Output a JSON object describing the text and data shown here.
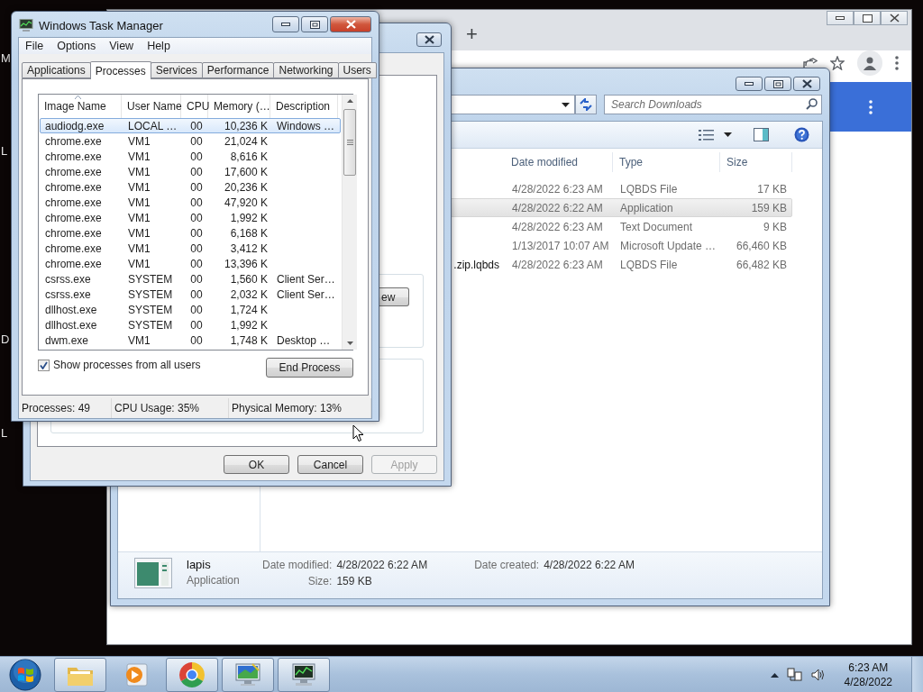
{
  "desktop": {
    "edge_letters": [
      "M",
      "L",
      "D",
      "L"
    ]
  },
  "browser": {
    "new_tab_button": "+"
  },
  "explorer": {
    "search": {
      "placeholder": "Search Downloads"
    },
    "columns": [
      "Date modified",
      "Type",
      "Size"
    ],
    "files": [
      {
        "date": "4/28/2022 6:23 AM",
        "type": "LQBDS File",
        "size": "17 KB",
        "selected": false
      },
      {
        "date": "4/28/2022 6:22 AM",
        "type": "Application",
        "size": "159 KB",
        "selected": true
      },
      {
        "date": "4/28/2022 6:23 AM",
        "type": "Text Document",
        "size": "9 KB",
        "selected": false
      },
      {
        "date": "1/13/2017 10:07 AM",
        "type": "Microsoft Update …",
        "size": "66,460 KB",
        "selected": false
      },
      {
        "name": ".zip.lqbds",
        "date": "4/28/2022 6:23 AM",
        "type": "LQBDS File",
        "size": "66,482 KB",
        "selected": false
      }
    ],
    "details": {
      "name": "lapis",
      "type": "Application",
      "field_groups": [
        [
          {
            "label": "Date modified:",
            "value": "4/28/2022 6:22 AM"
          },
          {
            "label": "Size:",
            "value": "159 KB"
          }
        ],
        [
          {
            "label": "Date created:",
            "value": "4/28/2022 6:22 AM"
          }
        ]
      ]
    }
  },
  "dialog": {
    "partial_button": "ew",
    "buttons": [
      {
        "label": "OK",
        "disabled": false
      },
      {
        "label": "Cancel",
        "disabled": false
      },
      {
        "label": "Apply",
        "disabled": true
      }
    ]
  },
  "task_manager": {
    "title": "Windows Task Manager",
    "menu": [
      "File",
      "Options",
      "View",
      "Help"
    ],
    "tabs": [
      {
        "label": "Applications",
        "selected": false
      },
      {
        "label": "Processes",
        "selected": true
      },
      {
        "label": "Services",
        "selected": false
      },
      {
        "label": "Performance",
        "selected": false
      },
      {
        "label": "Networking",
        "selected": false
      },
      {
        "label": "Users",
        "selected": false
      }
    ],
    "columns": [
      "Image Name",
      "User Name",
      "CPU",
      "Memory (…",
      "Description"
    ],
    "processes": [
      {
        "image": "audiodg.exe",
        "user": "LOCAL …",
        "cpu": "00",
        "memory": "10,236 K",
        "description": "Windows …",
        "selected": true
      },
      {
        "image": "chrome.exe",
        "user": "VM1",
        "cpu": "00",
        "memory": "21,024 K",
        "selected": false
      },
      {
        "image": "chrome.exe",
        "user": "VM1",
        "cpu": "00",
        "memory": "8,616 K",
        "selected": false
      },
      {
        "image": "chrome.exe",
        "user": "VM1",
        "cpu": "00",
        "memory": "17,600 K",
        "selected": false
      },
      {
        "image": "chrome.exe",
        "user": "VM1",
        "cpu": "00",
        "memory": "20,236 K",
        "selected": false
      },
      {
        "image": "chrome.exe",
        "user": "VM1",
        "cpu": "00",
        "memory": "47,920 K",
        "selected": false
      },
      {
        "image": "chrome.exe",
        "user": "VM1",
        "cpu": "00",
        "memory": "1,992 K",
        "selected": false
      },
      {
        "image": "chrome.exe",
        "user": "VM1",
        "cpu": "00",
        "memory": "6,168 K",
        "selected": false
      },
      {
        "image": "chrome.exe",
        "user": "VM1",
        "cpu": "00",
        "memory": "3,412 K",
        "selected": false
      },
      {
        "image": "chrome.exe",
        "user": "VM1",
        "cpu": "00",
        "memory": "13,396 K",
        "selected": false
      },
      {
        "image": "csrss.exe",
        "user": "SYSTEM",
        "cpu": "00",
        "memory": "1,560 K",
        "description": "Client Ser…",
        "selected": false
      },
      {
        "image": "csrss.exe",
        "user": "SYSTEM",
        "cpu": "00",
        "memory": "2,032 K",
        "description": "Client Ser…",
        "selected": false
      },
      {
        "image": "dllhost.exe",
        "user": "SYSTEM",
        "cpu": "00",
        "memory": "1,724 K",
        "selected": false
      },
      {
        "image": "dllhost.exe",
        "user": "SYSTEM",
        "cpu": "00",
        "memory": "1,992 K",
        "selected": false
      },
      {
        "image": "dwm.exe",
        "user": "VM1",
        "cpu": "00",
        "memory": "1,748 K",
        "description": "Desktop …",
        "selected": false
      }
    ],
    "show_all_users": {
      "label": "Show processes from all users",
      "checked": true
    },
    "end_button": "End Process",
    "status": [
      "Processes: 49",
      "CPU Usage: 35%",
      "Physical Memory: 13%"
    ]
  },
  "taskbar": {
    "apps": [
      {
        "kind": "folder",
        "open": true
      },
      {
        "kind": "media",
        "open": false
      },
      {
        "kind": "browser",
        "open": true
      },
      {
        "kind": "monitor",
        "open": true
      },
      {
        "kind": "task_manager",
        "open": true
      }
    ],
    "clock": {
      "time": "6:23 AM",
      "date": "4/28/2022"
    }
  }
}
